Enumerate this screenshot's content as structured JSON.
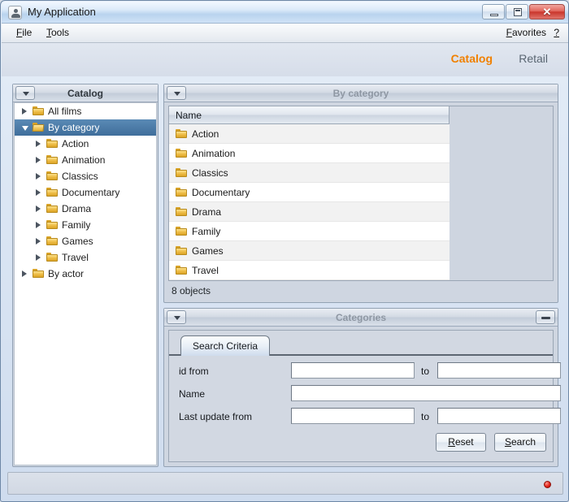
{
  "window": {
    "title": "My Application",
    "icon": "user-icon",
    "controls": {
      "minimize": "minimize-icon",
      "maximize": "maximize-icon",
      "close": "✕"
    }
  },
  "menubar": {
    "items": [
      {
        "label": "File",
        "mnemonic": "F"
      },
      {
        "label": "Tools",
        "mnemonic": "T"
      }
    ],
    "right_items": [
      {
        "label": "Favorites",
        "mnemonic": "F"
      },
      {
        "label": "?",
        "mnemonic": ""
      }
    ]
  },
  "module_tabs": {
    "active_color": "#f08000",
    "inactive_color": "#5a6672",
    "items": [
      {
        "label": "Catalog",
        "active": true
      },
      {
        "label": "Retail",
        "active": false
      }
    ]
  },
  "sidebar": {
    "title": "Catalog",
    "collapse_icon": "chevron-down-icon",
    "selection_color": "#3f6e9b",
    "tree": [
      {
        "label": "All films",
        "depth": 0,
        "state": "collapsed",
        "selected": false,
        "folder": "closed"
      },
      {
        "label": "By category",
        "depth": 0,
        "state": "expanded",
        "selected": true,
        "folder": "open"
      },
      {
        "label": "Action",
        "depth": 1,
        "state": "collapsed",
        "selected": false,
        "folder": "closed"
      },
      {
        "label": "Animation",
        "depth": 1,
        "state": "collapsed",
        "selected": false,
        "folder": "closed"
      },
      {
        "label": "Classics",
        "depth": 1,
        "state": "collapsed",
        "selected": false,
        "folder": "closed"
      },
      {
        "label": "Documentary",
        "depth": 1,
        "state": "collapsed",
        "selected": false,
        "folder": "closed"
      },
      {
        "label": "Drama",
        "depth": 1,
        "state": "collapsed",
        "selected": false,
        "folder": "closed"
      },
      {
        "label": "Family",
        "depth": 1,
        "state": "collapsed",
        "selected": false,
        "folder": "closed"
      },
      {
        "label": "Games",
        "depth": 1,
        "state": "collapsed",
        "selected": false,
        "folder": "closed"
      },
      {
        "label": "Travel",
        "depth": 1,
        "state": "collapsed",
        "selected": false,
        "folder": "closed"
      },
      {
        "label": "By actor",
        "depth": 0,
        "state": "collapsed",
        "selected": false,
        "folder": "closed"
      }
    ]
  },
  "by_category_panel": {
    "title": "By category",
    "collapse_icon": "chevron-down-icon",
    "columns": [
      "Name"
    ],
    "rows": [
      {
        "name": "Action"
      },
      {
        "name": "Animation"
      },
      {
        "name": "Classics"
      },
      {
        "name": "Documentary"
      },
      {
        "name": "Drama"
      },
      {
        "name": "Family"
      },
      {
        "name": "Games"
      },
      {
        "name": "Travel"
      }
    ],
    "status": "8 objects"
  },
  "categories_panel": {
    "title": "Categories",
    "collapse_icon": "chevron-down-icon",
    "minimize_icon": "minimize-icon",
    "tabs": [
      {
        "label": "Search Criteria",
        "active": true
      }
    ],
    "fields": [
      {
        "label": "id from",
        "value": "",
        "placeholder": "",
        "has_to": true,
        "to_label": "to",
        "to_value": ""
      },
      {
        "label": "Name",
        "value": "",
        "placeholder": "",
        "has_to": false,
        "to_label": "",
        "to_value": ""
      },
      {
        "label": "Last update from",
        "value": "",
        "placeholder": "",
        "has_to": true,
        "to_label": "to",
        "to_value": ""
      }
    ],
    "buttons": [
      {
        "label": "Reset",
        "mnemonic": "R"
      },
      {
        "label": "Search",
        "mnemonic": "S"
      }
    ]
  },
  "statusbar": {
    "indicator": "record-led-icon",
    "indicator_color": "#e4231a"
  }
}
